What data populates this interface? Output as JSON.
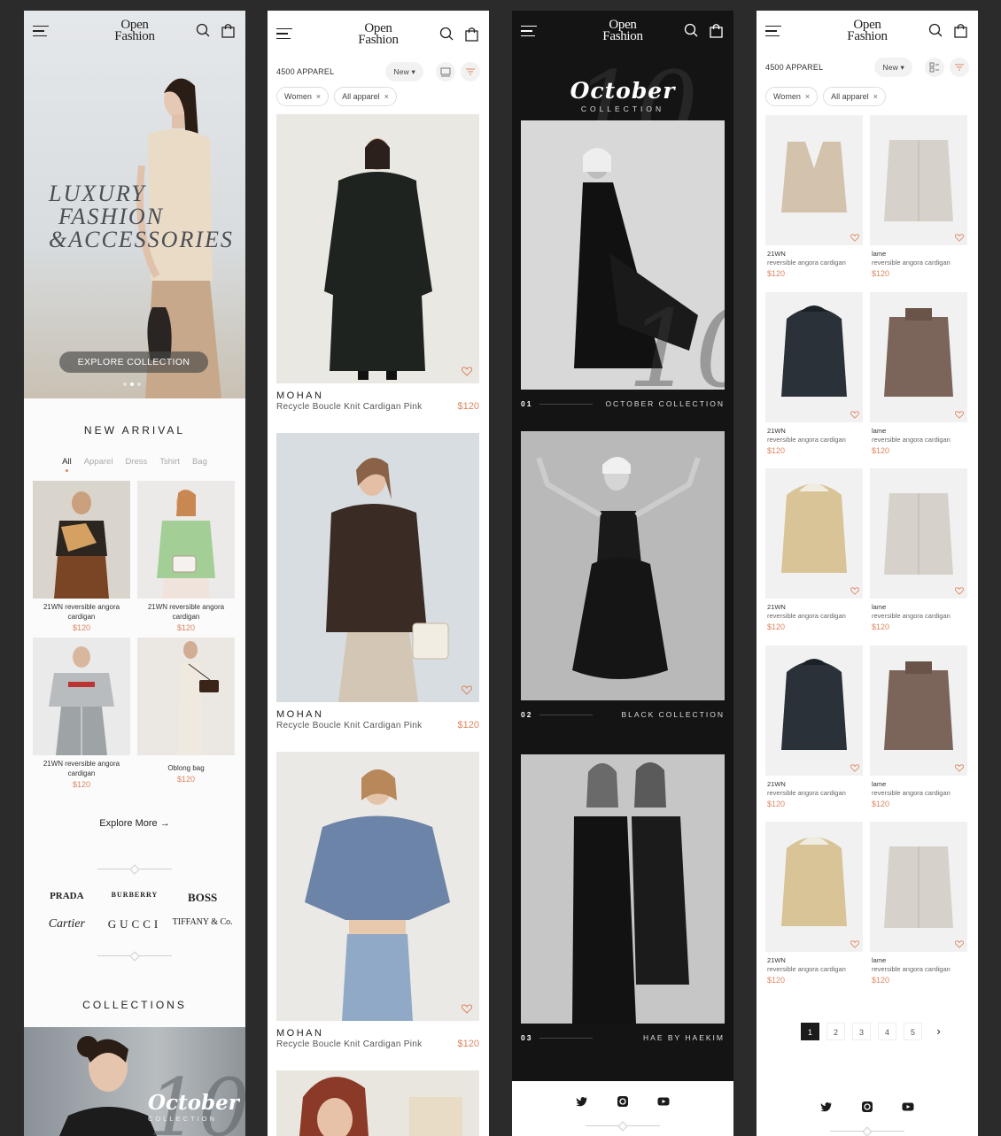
{
  "brand": {
    "logo_line1": "Open",
    "logo_line2": "Fashion"
  },
  "home": {
    "hero_title": [
      "LUXURY",
      "FASHION",
      "&ACCESSORIES"
    ],
    "hero_button": "EXPLORE COLLECTION",
    "new_arrival_title": "NEW ARRIVAL",
    "tabs": [
      "All",
      "Apparel",
      "Dress",
      "Tshirt",
      "Bag"
    ],
    "products": [
      {
        "name": "21WN reversible angora cardigan",
        "price": "$120"
      },
      {
        "name": "21WN reversible angora cardigan",
        "price": "$120"
      },
      {
        "name": "21WN reversible angora cardigan",
        "price": "$120"
      },
      {
        "name": "Oblong bag",
        "price": "$120"
      }
    ],
    "explore_more": "Explore More",
    "brands": [
      "PRADA",
      "BURBERRY",
      "BOSS",
      "Cartier",
      "GUCCI",
      "TIFFANY & Co."
    ],
    "collections_title": "COLLECTIONS",
    "banner_title": "October",
    "banner_sub": "COLLECTION"
  },
  "listing": {
    "count": "4500 APPAREL",
    "sort": "New",
    "chips": [
      "Women",
      "All apparel"
    ],
    "items": [
      {
        "brand": "MOHAN",
        "name": "Recycle Boucle Knit Cardigan Pink",
        "price": "$120"
      },
      {
        "brand": "MOHAN",
        "name": "Recycle Boucle Knit Cardigan Pink",
        "price": "$120"
      },
      {
        "brand": "MOHAN",
        "name": "Recycle Boucle Knit Cardigan Pink",
        "price": "$120"
      }
    ]
  },
  "collection": {
    "title": "October",
    "subtitle": "COLLECTION",
    "items": [
      {
        "num": "01",
        "label": "OCTOBER COLLECTION"
      },
      {
        "num": "02",
        "label": "BLACK COLLECTION"
      },
      {
        "num": "03",
        "label": "HAE BY HAEKIM"
      }
    ]
  },
  "grid": {
    "count": "4500 APPAREL",
    "sort": "New",
    "chips": [
      "Women",
      "All apparel"
    ],
    "items": [
      {
        "brand": "21WN",
        "name": "reversible angora cardigan",
        "price": "$120"
      },
      {
        "brand": "lame",
        "name": "reversible angora cardigan",
        "price": "$120"
      },
      {
        "brand": "21WN",
        "name": "reversible angora cardigan",
        "price": "$120"
      },
      {
        "brand": "lame",
        "name": "reversible angora cardigan",
        "price": "$120"
      },
      {
        "brand": "21WN",
        "name": "reversible angora cardigan",
        "price": "$120"
      },
      {
        "brand": "lame",
        "name": "reversible angora cardigan",
        "price": "$120"
      },
      {
        "brand": "21WN",
        "name": "reversible angora cardigan",
        "price": "$120"
      },
      {
        "brand": "lame",
        "name": "reversible angora cardigan",
        "price": "$120"
      },
      {
        "brand": "21WN",
        "name": "reversible angora cardigan",
        "price": "$120"
      },
      {
        "brand": "lame",
        "name": "reversible angora cardigan",
        "price": "$120"
      }
    ],
    "pages": [
      "1",
      "2",
      "3",
      "4",
      "5"
    ]
  },
  "colors": {
    "accent": "#dd8560",
    "dark": "#141414"
  },
  "icons": [
    "menu-icon",
    "search-icon",
    "bag-icon",
    "heart-icon",
    "close-icon",
    "arrow-right-icon",
    "twitter-icon",
    "instagram-icon",
    "youtube-icon"
  ]
}
